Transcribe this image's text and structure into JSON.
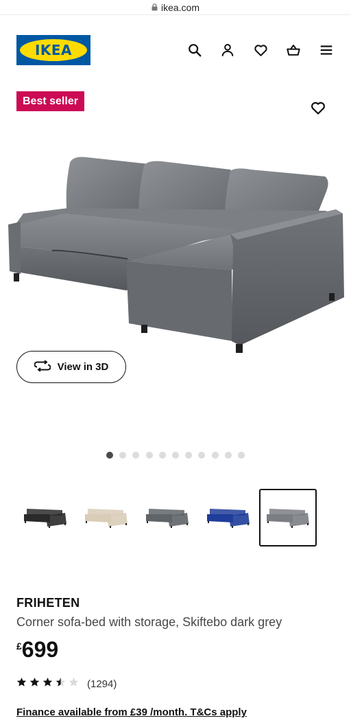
{
  "browser": {
    "url": "ikea.com"
  },
  "header": {
    "logo_text": "IKEA",
    "icons": [
      "search-icon",
      "account-icon",
      "heart-icon",
      "basket-icon",
      "menu-icon"
    ]
  },
  "product": {
    "badge": "Best seller",
    "view3d_label": "View in 3D",
    "gallery": {
      "total": 11,
      "active_index": 0
    },
    "color_variants": [
      {
        "name": "black",
        "color": "#2a2a2a"
      },
      {
        "name": "beige",
        "color": "#d9cdb8"
      },
      {
        "name": "grey",
        "color": "#5f6469"
      },
      {
        "name": "blue",
        "color": "#1f3d99"
      },
      {
        "name": "dark-grey",
        "color": "#7b7e83",
        "selected": true
      }
    ],
    "name": "FRIHETEN",
    "description": "Corner sofa-bed with storage, Skiftebo dark grey",
    "price_currency": "£",
    "price_amount": "699",
    "rating": 3.5,
    "rating_max": 5,
    "review_count": "(1294)",
    "finance_text": "Finance available from £39 /month. T&Cs apply"
  },
  "colors": {
    "badge": "#cc0b55",
    "ikea_blue": "#0058a3",
    "ikea_yellow": "#ffdb00"
  }
}
